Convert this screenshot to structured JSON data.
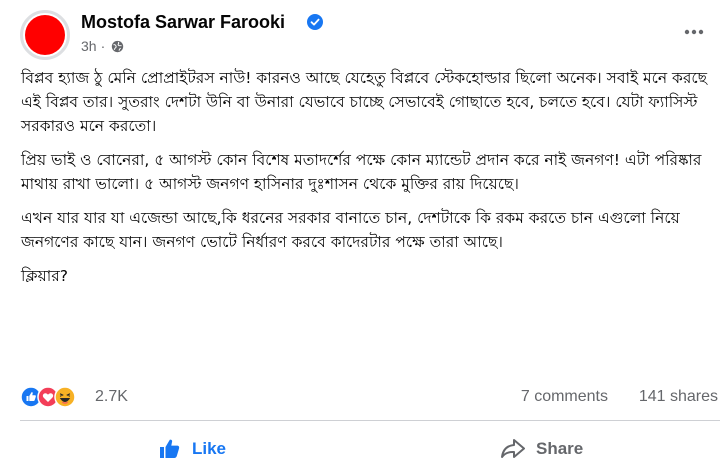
{
  "post": {
    "author": "Mostofa Sarwar Farooki",
    "time": "3h",
    "separator": "·",
    "paragraphs": [
      "বিপ্লব হ্যাজ ঠু মেনি প্রোপ্রাইটরস নাউ! কারনও আছে যেহেতু বিপ্লবে স্টেকহোল্ডার ছিলো অনেক। সবাই মনে করছে এই বিপ্লব তার। সুতরাং দেশটা উনি বা উনারা যেভাবে চাচ্ছে সেভাবেই গোছাতে হবে, চলতে হবে। যেটা ফ্যাসিস্ট সরকারও মনে করতো।",
      "প্রিয় ভাই ও বোনেরা, ৫ আগস্ট কোন বিশেষ মতাদর্শের পক্ষে কোন ম্যান্ডেট প্রদান করে নাই জনগণ! এটা পরিষ্কার মাথায় রাখা ভালো। ৫ আগস্ট জনগণ হাসিনার দুঃশাসন থেকে মুক্তির রায় দিয়েছে।",
      "এখন যার যার যা এজেন্ডা আছে,কি ধরনের সরকার বানাতে চান, দেশটাকে কি রকম করতে চান এগুলো নিয়ে জনগণের কাছে যান। জনগণ ভোটে নির্ধারণ করবে কাদেরটার পক্ষে তারা আছে।",
      "ক্লিয়ার?"
    ]
  },
  "stats": {
    "reactions": "2.7K",
    "comments": "7 comments",
    "shares": "141 shares"
  },
  "actions": {
    "like": "Like",
    "share": "Share"
  },
  "colors": {
    "brand_blue": "#1877f2",
    "avatar_red": "#ff0000",
    "muted_text": "#65676b"
  },
  "icons": {
    "verified": "verified-badge-icon",
    "privacy": "globe-icon",
    "menu": "more-options-icon",
    "reactions": [
      "like-reaction-icon",
      "love-reaction-icon",
      "haha-reaction-icon"
    ],
    "like": "thumbs-up-icon",
    "share": "share-arrow-icon"
  }
}
